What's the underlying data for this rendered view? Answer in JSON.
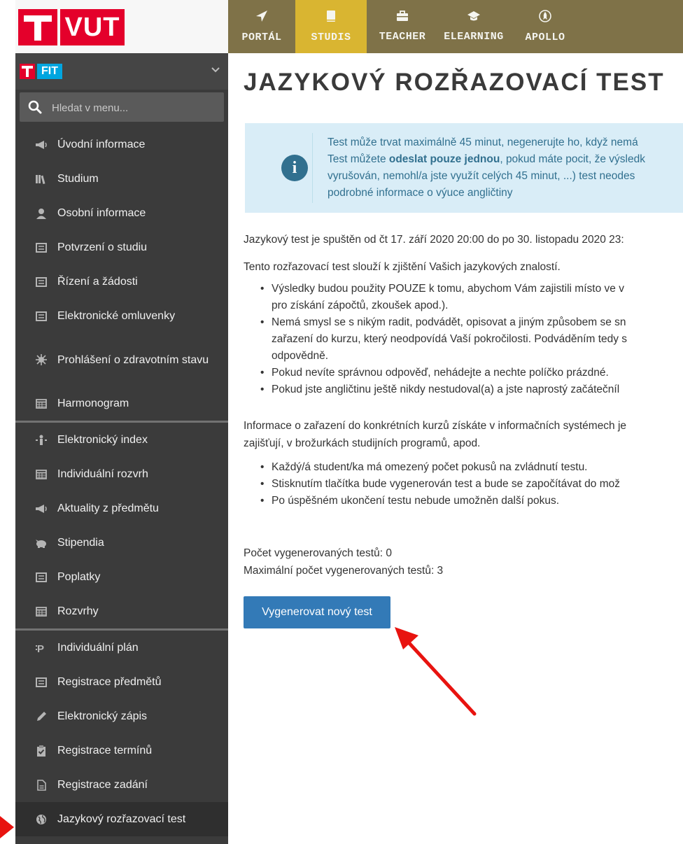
{
  "brand": {
    "university": "VUT",
    "faculty": "FIT"
  },
  "search": {
    "placeholder": "Hledat v menu..."
  },
  "topnav": [
    {
      "label": "PORTÁL",
      "icon": "paper-plane-icon"
    },
    {
      "label": "STUDIS",
      "icon": "book-icon",
      "active": true
    },
    {
      "label": "TEACHER",
      "icon": "briefcase-icon"
    },
    {
      "label": "ELEARNING",
      "icon": "graduation-cap-icon"
    },
    {
      "label": "APOLLO",
      "icon": "rocket-icon"
    }
  ],
  "sidebar": {
    "items": [
      {
        "label": "Úvodní informace",
        "icon": "megaphone-icon"
      },
      {
        "label": "Studium",
        "icon": "books-icon"
      },
      {
        "label": "Osobní informace",
        "icon": "user-icon"
      },
      {
        "label": "Potvrzení o studiu",
        "icon": "document-icon"
      },
      {
        "label": "Řízení a žádosti",
        "icon": "document-icon"
      },
      {
        "label": "Elektronické omluvenky",
        "icon": "document-icon"
      },
      {
        "label": "Prohlášení o zdravotním stavu",
        "icon": "virus-icon"
      },
      {
        "label": "Harmonogram",
        "icon": "calendar-icon"
      },
      {
        "label": "Elektronický index",
        "icon": "index-icon"
      },
      {
        "label": "Individuální rozvrh",
        "icon": "calendar-icon"
      },
      {
        "label": "Aktuality z předmětu",
        "icon": "megaphone-icon"
      },
      {
        "label": "Stipendia",
        "icon": "piggy-bank-icon"
      },
      {
        "label": "Poplatky",
        "icon": "document-icon"
      },
      {
        "label": "Rozvrhy",
        "icon": "calendar-icon"
      },
      {
        "label": "Individuální plán",
        "icon": "plan-icon"
      },
      {
        "label": "Registrace předmětů",
        "icon": "document-icon"
      },
      {
        "label": "Elektronický zápis",
        "icon": "pencil-icon"
      },
      {
        "label": "Registrace termínů",
        "icon": "clipboard-check-icon"
      },
      {
        "label": "Registrace zadání",
        "icon": "file-icon"
      },
      {
        "label": "Jazykový rozřazovací test",
        "icon": "globe-icon",
        "active": true
      }
    ]
  },
  "page": {
    "title": "JAZYKOVÝ ROZŘAZOVACÍ TEST",
    "info": {
      "line1": "Test může trvat maximálně 45 minut, negenerujte ho, když nemá",
      "line2_pre": "Test můžete ",
      "line2_bold": "odeslat pouze jednou",
      "line2_post": ", pokud máte pocit, že výsledk",
      "line3": "vyrušován, nemohl/a jste využít celých 45 minut, ...) test neodes",
      "line4": "podrobné informace o výuce angličtiny"
    },
    "intro_date": "Jazykový test je spuštěn od čt 17. září 2020 20:00 do po 30. listopadu 2020 23:",
    "intro_purpose": "Tento rozřazovací test slouží k zjištění Vašich jazykových znalostí.",
    "bullets1": [
      "Výsledky budou použity POUZE k tomu, abychom Vám zajistili místo ve v",
      "pro získání zápočtů, zkoušek apod.).",
      "Nemá smysl se s nikým radit, podvádět, opisovat a jiným způsobem se sn",
      "zařazení do kurzu, který neodpovídá Vaší pokročilosti. Podváděním tedy s",
      "odpovědně.",
      "Pokud nevíte správnou odpověď, nehádejte a nechte políčko prázdné.",
      "Pokud jste angličtinu ještě nikdy nestudoval(a) a jste naprostý začátečníl"
    ],
    "courses_info_1": "Informace o zařazení do konkrétních kurzů získáte v informačních systémech je",
    "courses_info_2": "zajišťují, v brožurkách studijních programů, apod.",
    "bullets2": [
      "Každý/á student/ka má omezený počet pokusů na zvládnutí testu.",
      "Stisknutím tlačítka bude vygenerován test a bude se započítávat do mož",
      "Po úspěšném ukončení testu nebude umožněn další pokus."
    ],
    "generated_count": "Počet vygenerovaných testů: 0",
    "max_count": "Maximální počet vygenerovaných testů: 3",
    "generate_button": "Vygenerovat nový test"
  },
  "colors": {
    "sidebar_bg": "#3b3b3b",
    "topnav_bg": "#7f7248",
    "topnav_active": "#d9b531",
    "vut_red": "#e4002b",
    "fit_blue": "#00a6e0",
    "info_bg": "#d9edf7",
    "info_text": "#31708f",
    "button_bg": "#337ab7",
    "annotation_arrow": "#e8130f"
  }
}
